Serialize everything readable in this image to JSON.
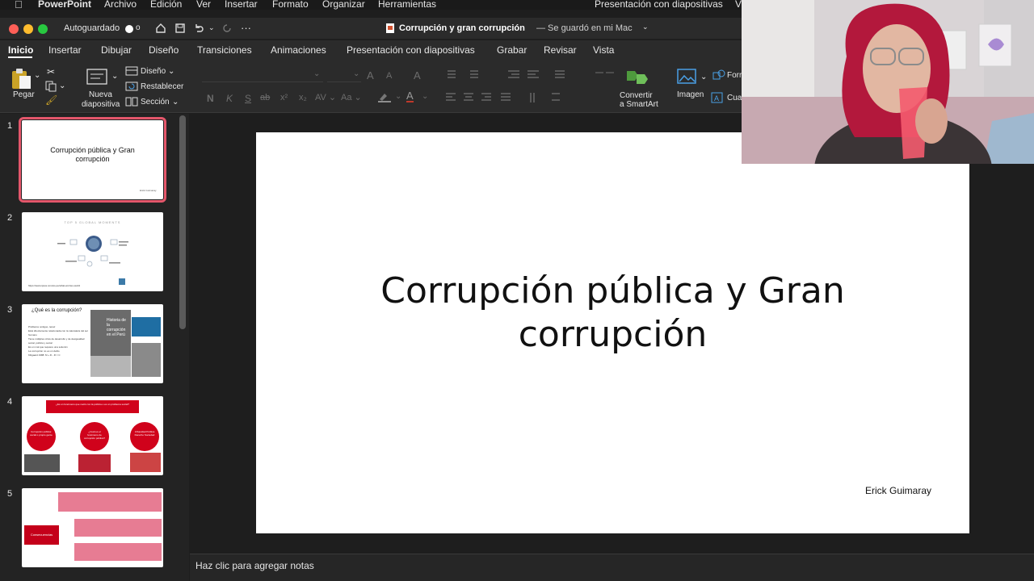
{
  "menubar": {
    "app_name": "PowerPoint",
    "items": [
      "Archivo",
      "Edición",
      "Ver",
      "Insertar",
      "Formato",
      "Organizar",
      "Herramientas"
    ],
    "right_item": "Presentación con diapositivas",
    "cut_item": "V"
  },
  "titlebar": {
    "autosave_label": "Autoguardado",
    "autosave_state": "o",
    "doc_title": "Corrupción y gran corrupción",
    "save_status": "— Se guardó en mi Mac"
  },
  "ribbon_tabs": [
    "Inicio",
    "Insertar",
    "Dibujar",
    "Diseño",
    "Transiciones",
    "Animaciones",
    "Presentación con diapositivas",
    "Grabar",
    "Revisar",
    "Vista"
  ],
  "ribbon": {
    "paste_label": "Pegar",
    "new_slide_label_1": "Nueva",
    "new_slide_label_2": "diapositiva",
    "layout_label": "Diseño",
    "reset_label": "Restablecer",
    "section_label": "Sección",
    "font_n": "N",
    "font_k": "K",
    "font_s": "S",
    "font_abc": "ab",
    "font_x2": "x²",
    "font_x2b": "x₂",
    "smartart_1": "Convertir",
    "smartart_2": "a SmartArt",
    "image_label": "Imagen",
    "form_cut": "Forr",
    "cuad_cut": "Cuad"
  },
  "slides": [
    {
      "number": "1",
      "title": "Corrupción pública y Gran corrupción",
      "author": "Erick Guimaray"
    },
    {
      "number": "2",
      "heading": "TOP 5 GLOBAL MOMENTS",
      "link": "https://www.ipsos.com/es-pe/what-worries-world"
    },
    {
      "number": "3",
      "heading": "¿Qué es la corrupción?",
      "bullets": [
        "Problema: antiguo, tenaz",
        "Está directamente relacionada con la naturaleza del ser humano",
        "Tiene múltiples crisis de desarrollo y de desigualdad social, política y social",
        "Es un mal que requiere una solución",
        "La corrupción no es un delito",
        "Klitgaard 1988: M + D - R = C"
      ],
      "image_text": "Historia de la corrupción en el Perú"
    },
    {
      "number": "4",
      "banner": "¿Es un fenómeno que nació con la política o es un problema social?",
      "circles": [
        "Corrupción pública: social o propio gente",
        "¿Cuál es el fenómeno de corrupción pública?",
        "Urbanidad Política Derecho Sociedad"
      ]
    },
    {
      "number": "5",
      "left_box": "Consecuencias"
    }
  ],
  "main_slide": {
    "title_line_1": "Corrupción pública y Gran",
    "title_line_2": "corrupción",
    "author": "Erick Guimaray"
  },
  "notes_placeholder": "Haz clic para agregar notas",
  "colors": {
    "selected_outline": "#e4576b",
    "slide4_red": "#d0021b",
    "slide5_pink": "#e77c93"
  }
}
